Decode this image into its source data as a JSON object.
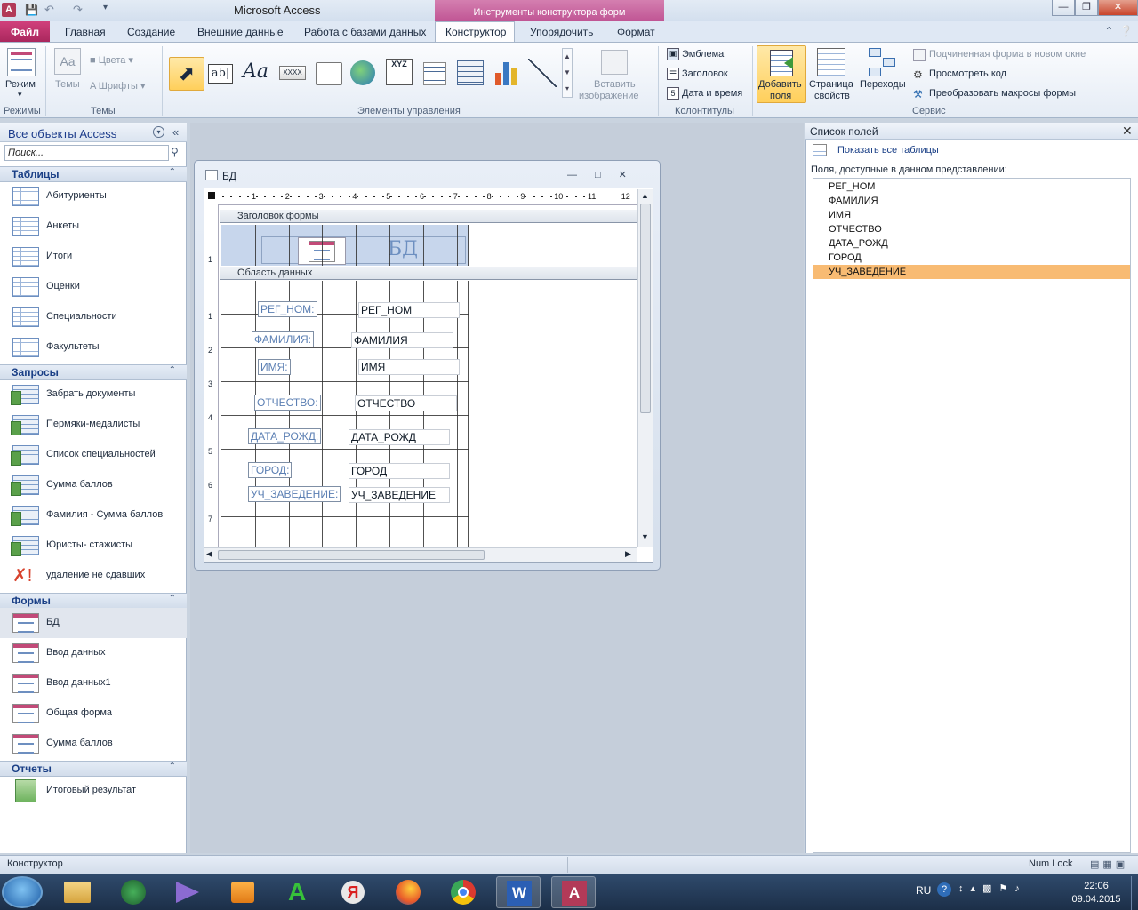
{
  "titlebar": {
    "app_title": "Microsoft Access",
    "context_title": "Инструменты конструктора форм",
    "app_icon_letter": "A"
  },
  "tabs": {
    "file": "Файл",
    "items": [
      "Главная",
      "Создание",
      "Внешние данные",
      "Работа с базами данных",
      "Конструктор",
      "Упорядочить",
      "Формат"
    ],
    "active_index": 4
  },
  "ribbon": {
    "groups": {
      "modes": "Режимы",
      "themes": "Темы",
      "controls": "Элементы управления",
      "headers": "Колонтитулы",
      "service": "Сервис"
    },
    "mode_button": "Режим",
    "themes_button": "Темы",
    "colors": "Цвета",
    "fonts": "Шрифты",
    "insert_image": [
      "Вставить",
      "изображение"
    ],
    "logo": "Эмблема",
    "title": "Заголовок",
    "datetime": "Дата и время",
    "add_fields": [
      "Добавить",
      "поля"
    ],
    "property_sheet": [
      "Страница",
      "свойств"
    ],
    "transitions": "Переходы",
    "subform_new_window": "Подчиненная форма в новом окне",
    "view_code": "Просмотреть код",
    "convert_macros": "Преобразовать макросы формы"
  },
  "nav": {
    "title": "Все объекты Access",
    "search_placeholder": "Поиск...",
    "sections": [
      {
        "title": "Таблицы",
        "items": [
          "Абитуриенты",
          "Анкеты",
          "Итоги",
          "Оценки",
          "Специальности",
          "Факультеты"
        ]
      },
      {
        "title": "Запросы",
        "items": [
          "Забрать документы",
          "Пермяки-медалисты",
          "Список специальностей",
          "Сумма баллов",
          "Фамилия - Сумма баллов",
          "Юристы- стажисты",
          "удаление не сдавших"
        ]
      },
      {
        "title": "Формы",
        "items": [
          "БД",
          "Ввод данных",
          "Ввод данных1",
          "Общая форма",
          "Сумма баллов"
        ]
      },
      {
        "title": "Отчеты",
        "items": [
          "Итоговый результат"
        ]
      }
    ]
  },
  "form_window": {
    "title": "БД",
    "header_band": "Заголовок формы",
    "detail_band": "Область данных",
    "header_title": "БД",
    "ruler_top": [
      "1",
      "2",
      "3",
      "4",
      "5",
      "6",
      "7",
      "8",
      "9",
      "10",
      "11",
      "12"
    ],
    "ruler_left": [
      "1",
      "1",
      "2",
      "3",
      "4",
      "5",
      "6",
      "7"
    ],
    "controls": [
      {
        "label": "РЕГ_НОМ:",
        "field": "РЕГ_НОМ"
      },
      {
        "label": "ФАМИЛИЯ:",
        "field": "ФАМИЛИЯ"
      },
      {
        "label": "ИМЯ:",
        "field": "ИМЯ"
      },
      {
        "label": "ОТЧЕСТВО:",
        "field": "ОТЧЕСТВО"
      },
      {
        "label": "ДАТА_РОЖД:",
        "field": "ДАТА_РОЖД"
      },
      {
        "label": "ГОРОД:",
        "field": "ГОРОД"
      },
      {
        "label": "УЧ_ЗАВЕДЕНИЕ:",
        "field": "УЧ_ЗАВЕДЕНИЕ"
      }
    ]
  },
  "field_list": {
    "title": "Список полей",
    "show_all": "Показать все таблицы",
    "subtitle": "Поля, доступные в данном представлении:",
    "fields": [
      "РЕГ_НОМ",
      "ФАМИЛИЯ",
      "ИМЯ",
      "ОТЧЕСТВО",
      "ДАТА_РОЖД",
      "ГОРОД",
      "УЧ_ЗАВЕДЕНИЕ"
    ],
    "selected_index": 6
  },
  "status": {
    "left": "Конструктор",
    "right": "Num Lock"
  },
  "tray": {
    "lang": "RU",
    "time": "22:06",
    "date": "09.04.2015"
  },
  "colors": {
    "accent": "#c05594",
    "selection": "#f8bb73",
    "header_area": "#c7d6ec"
  }
}
